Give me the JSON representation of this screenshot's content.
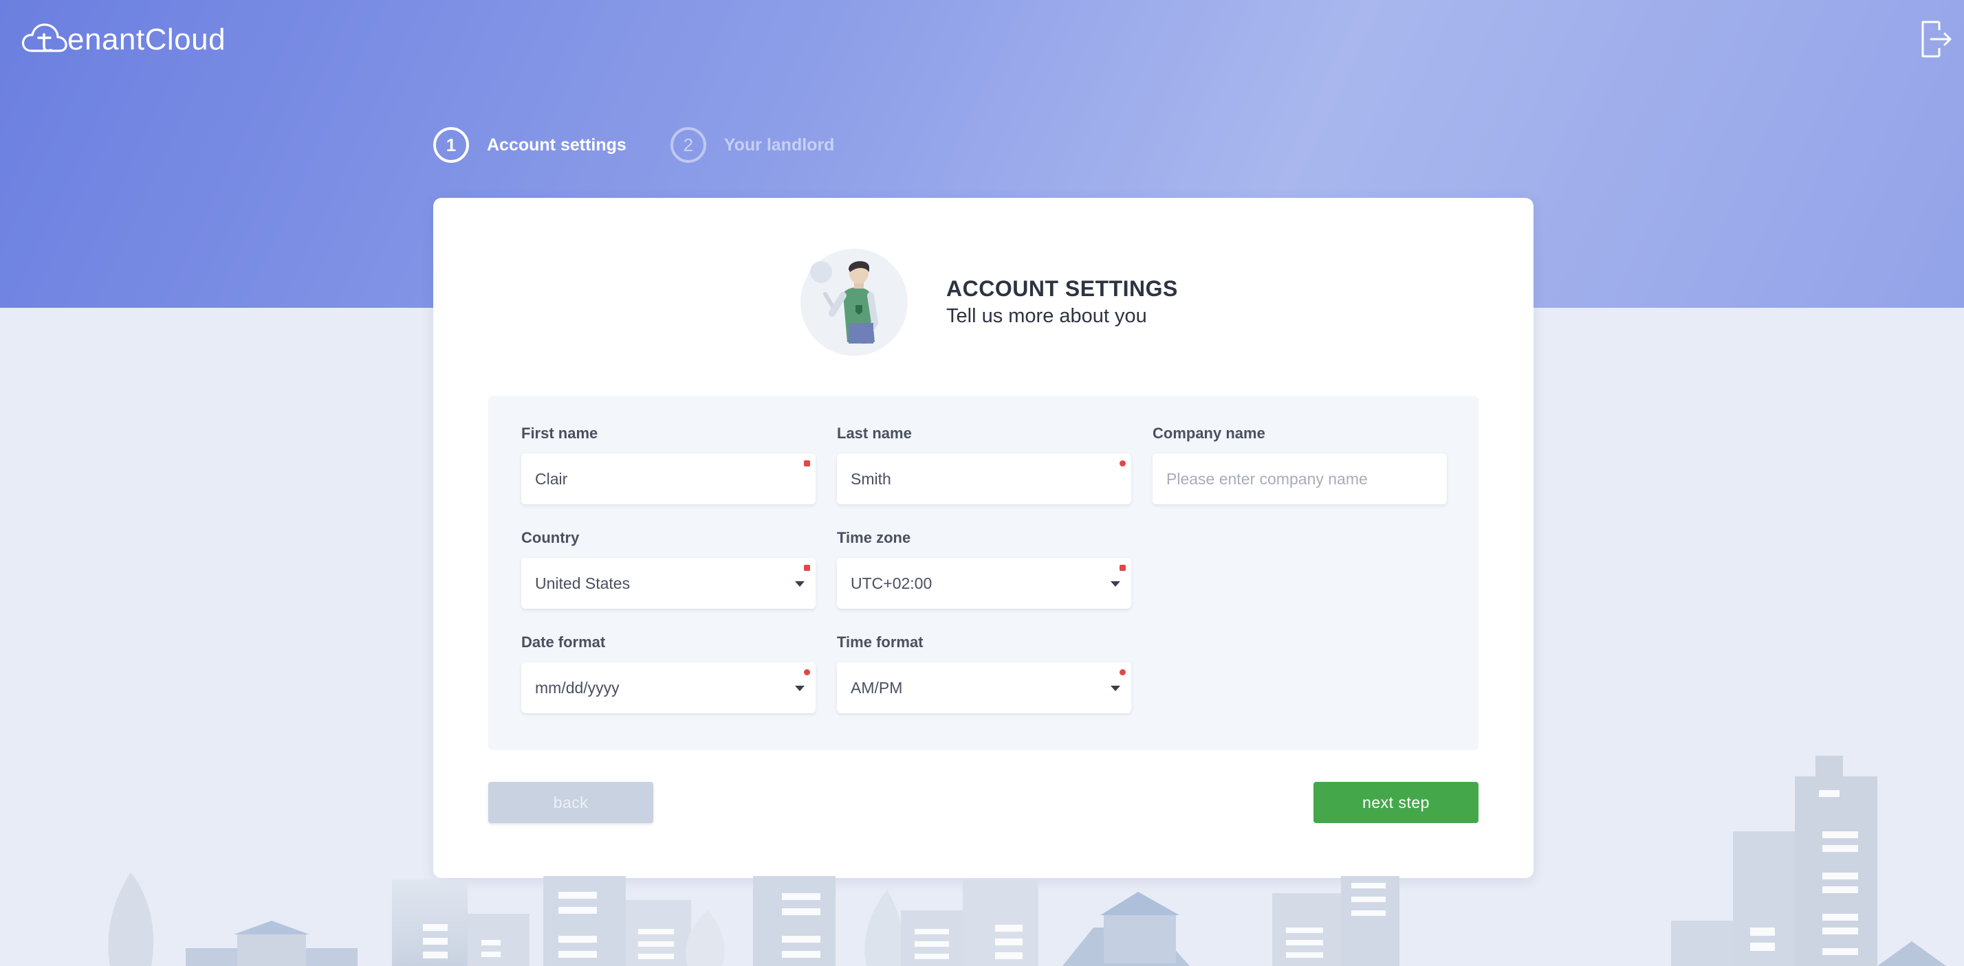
{
  "brand": {
    "name": "tenantCloud",
    "word_after_icon": "enantCloud",
    "icon": "cloud-t-logo"
  },
  "header": {
    "logout_icon": "logout-icon"
  },
  "steps": [
    {
      "number": "1",
      "label": "Account settings",
      "state": "active"
    },
    {
      "number": "2",
      "label": "Your landlord",
      "state": "inactive"
    }
  ],
  "card": {
    "title": "ACCOUNT SETTINGS",
    "subtitle": "Tell us more about you",
    "illustration": "person-illustration"
  },
  "form": {
    "first_name": {
      "label": "First name",
      "value": "Clair",
      "required": true
    },
    "last_name": {
      "label": "Last name",
      "value": "Smith",
      "required": true
    },
    "company_name": {
      "label": "Company name",
      "value": "",
      "placeholder": "Please enter company name",
      "required": false
    },
    "country": {
      "label": "Country",
      "value": "United States",
      "required": true
    },
    "time_zone": {
      "label": "Time zone",
      "value": "UTC+02:00",
      "required": true
    },
    "date_format": {
      "label": "Date format",
      "value": "mm/dd/yyyy",
      "required": true
    },
    "time_format": {
      "label": "Time format",
      "value": "AM/PM",
      "required": true
    }
  },
  "buttons": {
    "back": "back",
    "next": "next step"
  },
  "colors": {
    "hero_start": "#6b7fe0",
    "hero_end": "#a9b7ee",
    "primary_green": "#44a84a",
    "required_marker": "#e04848",
    "back_disabled": "#c9d2e0"
  }
}
